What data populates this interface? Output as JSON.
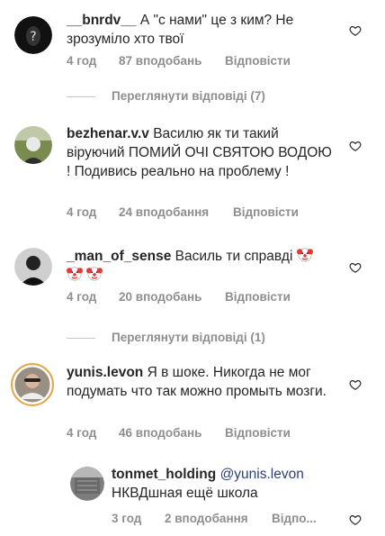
{
  "comments": [
    {
      "username": "__bnrdv__",
      "text": "А \"с нами\" це з ким? Не зрозуміло хто твої",
      "time": "4 год",
      "likes": "87 вподобань",
      "reply": "Відповісти"
    },
    {
      "username": "bezhenar.v.v",
      "text": "Василю як ти такий віруючий ПОМИЙ ОЧІ СВЯТОЮ ВОДОЮ ! Подивись реально на проблему !",
      "time": "4 год",
      "likes": "24 вподобання",
      "reply": "Відповісти"
    },
    {
      "username": "_man_of_sense",
      "text": "Василь ти справді",
      "time": "4 год",
      "likes": "20 вподобань",
      "reply": "Відповісти"
    },
    {
      "username": "yunis.levon",
      "text": "Я в шоке. Никогда не мог подумать что так можно промыть мозги.",
      "time": "4 год",
      "likes": "46 вподобань",
      "reply": "Відповісти"
    }
  ],
  "reply": {
    "username": "tonmet_holding",
    "mention": "@yunis.levon",
    "text": "НКВДшная ещё школа",
    "time": "3 год",
    "likes": "2 вподобання",
    "reply": "Відпо..."
  },
  "view_replies": [
    {
      "label": "Переглянути відповіді (7)"
    },
    {
      "label": "Переглянути відповіді (1)"
    }
  ],
  "icons": {
    "like": "heart-icon",
    "emoji": "clown-face-icon"
  },
  "colors": {
    "text": "#262626",
    "meta": "#8e8e8e",
    "mention": "#2b3f73"
  }
}
